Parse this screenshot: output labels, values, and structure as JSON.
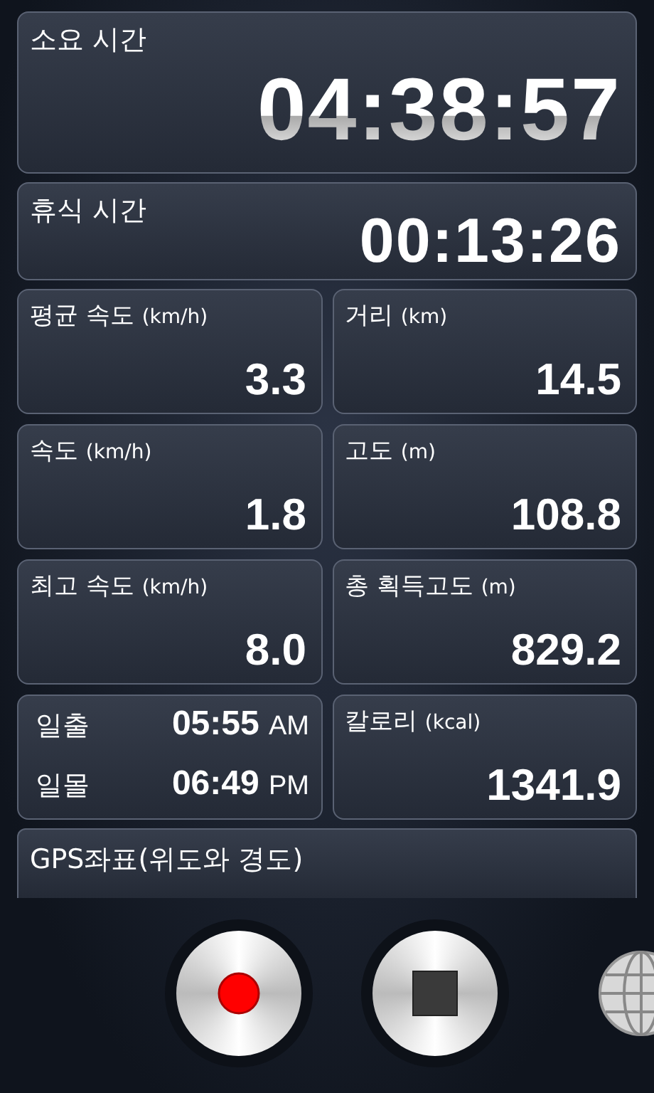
{
  "elapsed": {
    "label": "소요 시간",
    "value": "04:38:57"
  },
  "rest": {
    "label": "휴식 시간",
    "value": "00:13:26"
  },
  "tiles": [
    {
      "kind": "stat",
      "label": "평균 속도",
      "unit": "(km/h)",
      "value": "3.3"
    },
    {
      "kind": "stat",
      "label": "거리",
      "unit": "(km)",
      "value": "14.5"
    },
    {
      "kind": "stat",
      "label": "속도",
      "unit": "(km/h)",
      "value": "1.8"
    },
    {
      "kind": "stat",
      "label": "고도",
      "unit": "(m)",
      "value": "108.8"
    },
    {
      "kind": "stat",
      "label": "최고 속도",
      "unit": "(km/h)",
      "value": "8.0"
    },
    {
      "kind": "stat",
      "label": "총 획득고도",
      "unit": "(m)",
      "value": "829.2"
    },
    {
      "kind": "sun",
      "rows": [
        {
          "label": "일출",
          "time": "05:55",
          "period": "AM"
        },
        {
          "label": "일몰",
          "time": "06:49",
          "period": "PM"
        }
      ]
    },
    {
      "kind": "stat",
      "label": "칼로리",
      "unit": "(kcal)",
      "value": "1341.9"
    }
  ],
  "gps": {
    "label": "GPS좌표(위도와 경도)"
  },
  "controls": [
    {
      "kind": "record"
    },
    {
      "kind": "stop"
    },
    {
      "kind": "globe"
    }
  ]
}
